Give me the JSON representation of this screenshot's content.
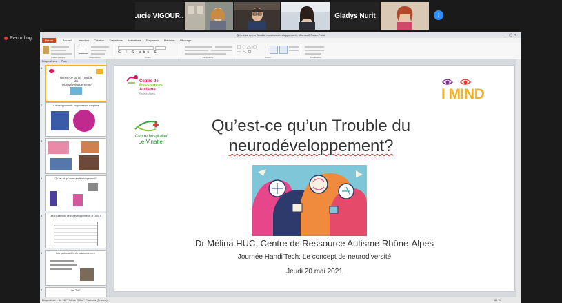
{
  "meeting": {
    "participants": [
      {
        "name": "Lucie VIGOUR..."
      },
      {
        "name": ""
      },
      {
        "name": ""
      },
      {
        "name": ""
      },
      {
        "name": "Gladys Nurit"
      },
      {
        "name": ""
      }
    ],
    "recording_label": "Recording"
  },
  "ppt": {
    "window_title": "Qu'est-ce qu'un Trouble du neurodéveloppement - Microsoft PowerPoint",
    "tabs": {
      "file": "Fichier",
      "accueil": "Accueil",
      "insertion": "Insertion",
      "creation": "Création",
      "transitions": "Transitions",
      "animations": "Animations",
      "diaporama": "Diaporama",
      "revision": "Révision",
      "affichage": "Affichage"
    },
    "ribbon_groups": [
      "Presse-papiers",
      "Diapositives",
      "Police",
      "Paragraphe",
      "Dessin",
      "Modification"
    ],
    "pane_tabs": [
      "Diapositives",
      "Plan"
    ],
    "status_text": "Diapositive 1 de 16   \"Thème Office\"   Français (France)",
    "zoom": "84 %",
    "thumb_numbers": [
      "1",
      "2",
      "3",
      "4",
      "5",
      "6",
      "7"
    ],
    "thumb_titles": [
      "Qu'est-ce qu'un Trouble du neurodéveloppement?",
      "Le développement : un processus complexe",
      "",
      "Qu'est-ce qu'un neurodéveloppement?",
      "Les troubles du neurodéveloppement : le DSM 5",
      "Les particularités du fonctionnement",
      "Les TND"
    ]
  },
  "slide": {
    "cra_logo_text": [
      "Centre de",
      "Ressources",
      "Autisme"
    ],
    "cra_logo_sub": "Rhône-Alpes",
    "ch_logo_text": [
      "Centre hospitalier",
      "Le Vinatier"
    ],
    "imind_logo": "I MIND",
    "title_line1": "Qu’est-ce qu’un Trouble du",
    "title_line2": "neurodéveloppement?",
    "author": "Dr Mélina HUC,  Centre de Ressource Autisme Rhône-Alpes",
    "journee": "Journée Handi’Tech: Le concept de neurodiversité",
    "date": "Jeudi 20 mai 2021"
  },
  "colors": {
    "accent": "#2d8cff",
    "ppt_file_tab": "#c94a1b",
    "selected_thumb": "#f0b323",
    "imind_yellow": "#f2b12b",
    "cra_pink": "#d81b60"
  }
}
